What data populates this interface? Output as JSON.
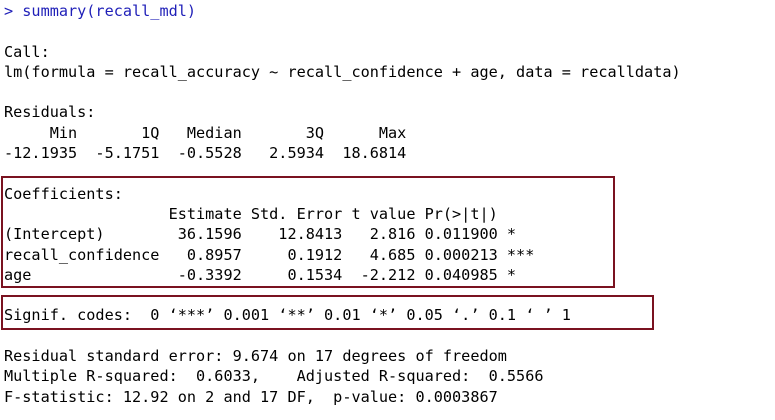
{
  "console": {
    "command_line": "> summary(recall_mdl)",
    "blank_line": "",
    "call_header": "Call:",
    "call_formula": "lm(formula = recall_accuracy ~ recall_confidence + age, data = recalldata)",
    "residuals_header": "Residuals:",
    "residuals_columns_line": "     Min       1Q   Median       3Q      Max ",
    "residuals_values_line": "-12.1935  -5.1751  -0.5528   2.5934  18.6814 ",
    "coefficients_header": "Coefficients:",
    "coefficients_columns_line": "                  Estimate Std. Error t value Pr(>|t|)    ",
    "coef_rows": [
      "(Intercept)        36.1596    12.8413   2.816 0.011900 *  ",
      "recall_confidence   0.8957     0.1912   4.685 0.000213 ***",
      "age                -0.3392     0.1534  -2.212 0.040985 *  "
    ],
    "separator_line": "---",
    "signif_codes_line": "Signif. codes:  0 ‘***’ 0.001 ‘**’ 0.01 ‘*’ 0.05 ‘.’ 0.1 ‘ ’ 1",
    "residual_se_line": "Residual standard error: 9.674 on 17 degrees of freedom",
    "r_squared_line": "Multiple R-squared:  0.6033,    Adjusted R-squared:  0.5566 ",
    "f_statistic_line": "F-statistic: 12.92 on 2 and 17 DF,  p-value: 0.0003867"
  },
  "colors": {
    "command_text": "#1f1fb8",
    "output_text": "#000000",
    "highlight_border": "#7a1220"
  }
}
